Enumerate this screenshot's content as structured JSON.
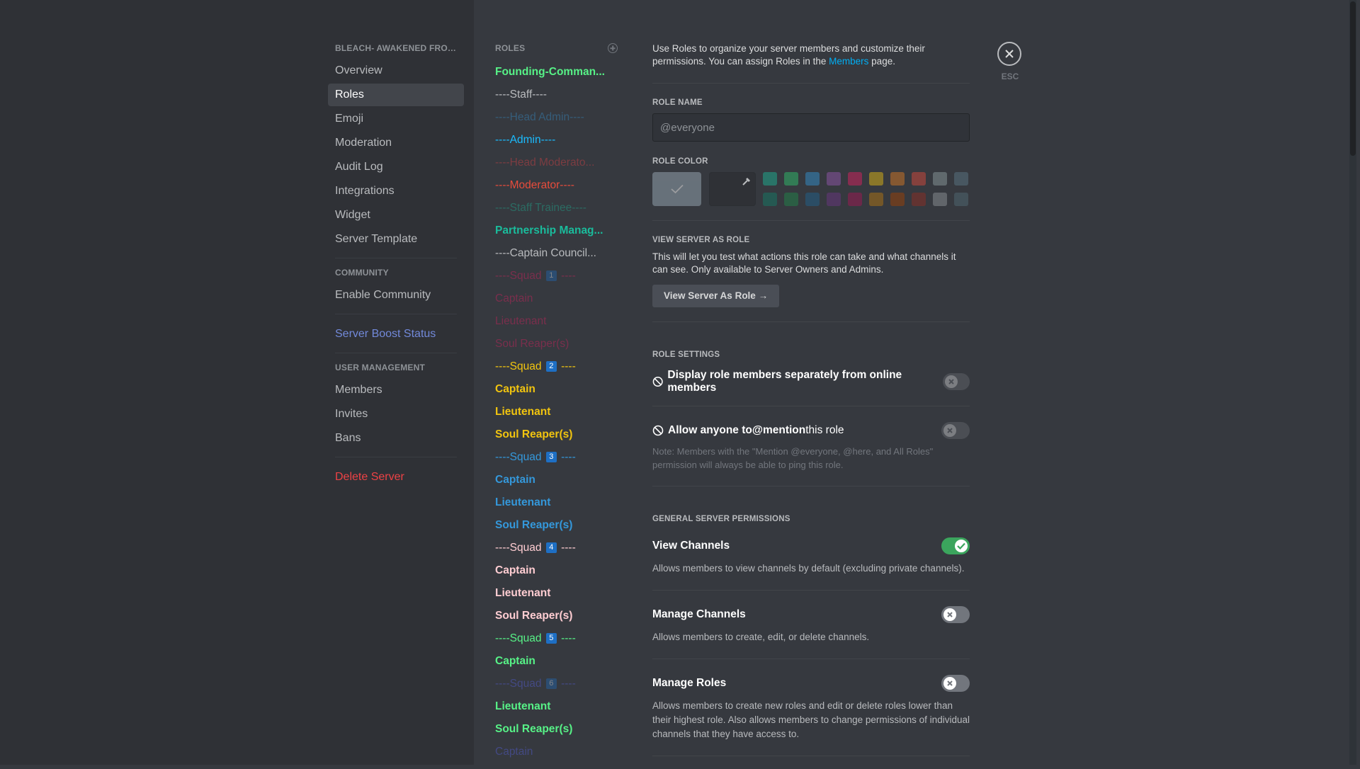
{
  "sidebar": {
    "server_name": "BLEACH- AWAKENED FRONTI...",
    "items": [
      {
        "label": "Overview"
      },
      {
        "label": "Roles"
      },
      {
        "label": "Emoji"
      },
      {
        "label": "Moderation"
      },
      {
        "label": "Audit Log"
      },
      {
        "label": "Integrations"
      },
      {
        "label": "Widget"
      },
      {
        "label": "Server Template"
      }
    ],
    "community_header": "COMMUNITY",
    "enable_community": "Enable Community",
    "boost_status": "Server Boost Status",
    "user_mgmt_header": "USER MANAGEMENT",
    "user_items": [
      {
        "label": "Members"
      },
      {
        "label": "Invites"
      },
      {
        "label": "Bans"
      }
    ],
    "delete_server": "Delete Server"
  },
  "roles": {
    "header": "ROLES",
    "list": [
      {
        "text": "Founding-Comman...",
        "color": "#57f287"
      },
      {
        "text": "----Staff----",
        "color": "#b9bbbe"
      },
      {
        "text": "----Head Admin----",
        "color": "#3498db"
      },
      {
        "text": "----Admin----",
        "color": "#1abcff"
      },
      {
        "text": "----Head Moderato...",
        "color": "#ed4245"
      },
      {
        "text": "----Moderator----",
        "color": "#e74c3c"
      },
      {
        "text": "----Staff Trainee----",
        "color": "#1abc9c"
      },
      {
        "text": "Partnership Manag...",
        "color": "#1abc9c"
      },
      {
        "text": "----Captain Council...",
        "color": "#b9bbbe"
      },
      {
        "pre": "----Squad ",
        "badge": "1",
        "post": " ----",
        "color": "#e91e63"
      },
      {
        "text": "Captain",
        "color": "#e91e63"
      },
      {
        "text": "Lieutenant",
        "color": "#e91e63"
      },
      {
        "text": "Soul Reaper(s)",
        "color": "#e91e63"
      },
      {
        "pre": "----Squad ",
        "badge": "2",
        "post": " ----",
        "color": "#f1c40f"
      },
      {
        "text": "Captain",
        "color": "#f1c40f"
      },
      {
        "text": "Lieutenant",
        "color": "#f1c40f"
      },
      {
        "text": "Soul Reaper(s)",
        "color": "#f1c40f"
      },
      {
        "pre": "----Squad ",
        "badge": "3",
        "post": " ----",
        "color": "#3498db"
      },
      {
        "text": "Captain",
        "color": "#3498db"
      },
      {
        "text": "Lieutenant",
        "color": "#3498db"
      },
      {
        "text": "Soul Reaper(s)",
        "color": "#3498db"
      },
      {
        "pre": "----Squad ",
        "badge": "4",
        "post": " ----",
        "color": "#ffcdd2"
      },
      {
        "text": "Captain",
        "color": "#ffcdd2"
      },
      {
        "text": "Lieutenant",
        "color": "#ffcdd2"
      },
      {
        "text": "Soul Reaper(s)",
        "color": "#ffcdd2"
      },
      {
        "pre": "----Squad ",
        "badge": "5",
        "post": " ----",
        "color": "#57f287"
      },
      {
        "text": "Captain",
        "color": "#57f287"
      },
      {
        "pre": "----Squad ",
        "badge": "6",
        "post": " ----",
        "color": "#5865f2"
      },
      {
        "text": "Lieutenant",
        "color": "#57f287"
      },
      {
        "text": "Soul Reaper(s)",
        "color": "#57f287"
      },
      {
        "text": "Captain",
        "color": "#5865f2"
      }
    ]
  },
  "main": {
    "intro_1": "Use Roles to organize your server members and customize their permissions. You can assign Roles in the ",
    "intro_link": "Members",
    "intro_2": " page.",
    "role_name_label": "ROLE NAME",
    "role_name_placeholder": "@everyone",
    "role_color_label": "ROLE COLOR",
    "swatches": [
      "#1abc9c",
      "#2ecc71",
      "#3498db",
      "#9b59b6",
      "#e91e63",
      "#f1c40f",
      "#e67e22",
      "#e74c3c",
      "#95a5a6",
      "#607d8b",
      "#11806a",
      "#1f8b4c",
      "#206694",
      "#71368a",
      "#ad1457",
      "#c27c0e",
      "#a84300",
      "#992d22",
      "#979c9f",
      "#546e7a"
    ],
    "view_as_label": "VIEW SERVER AS ROLE",
    "view_as_desc": "This will let you test what actions this role can take and what channels it can see. Only available to Server Owners and Admins.",
    "view_as_button": "View Server As Role",
    "role_settings_label": "ROLE SETTINGS",
    "display_separately": "Display role members separately from online members",
    "allow_mention_pre": "Allow anyone to ",
    "allow_mention_bold": "@mention",
    "allow_mention_post": " this role",
    "mention_note": "Note: Members with the \"Mention @everyone, @here, and All Roles\" permission will always be able to ping this role.",
    "general_label": "GENERAL SERVER PERMISSIONS",
    "perms": [
      {
        "title": "View Channels",
        "desc": "Allows members to view channels by default (excluding private channels).",
        "on": true
      },
      {
        "title": "Manage Channels",
        "desc": "Allows members to create, edit, or delete channels.",
        "on": false
      },
      {
        "title": "Manage Roles",
        "desc": "Allows members to create new roles and edit or delete roles lower than their highest role. Also allows members to change permissions of individual channels that they have access to.",
        "on": false
      }
    ],
    "esc": "ESC"
  }
}
